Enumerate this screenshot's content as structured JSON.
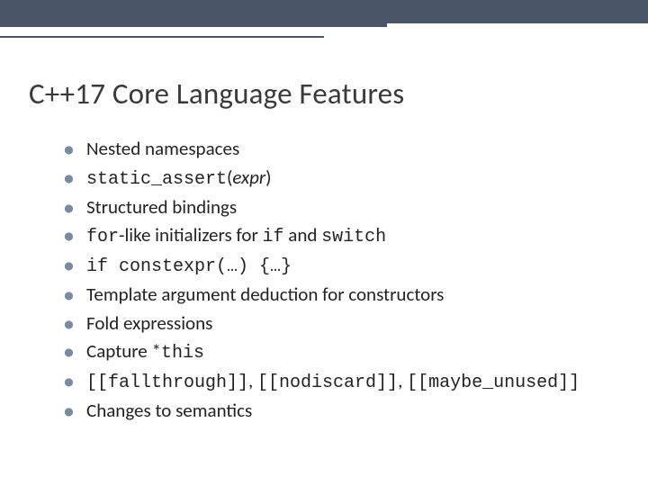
{
  "title": "C++17 Core Language Features",
  "bullets": {
    "b1": "Nested namespaces",
    "b2a": "static_assert",
    "b2b": "(",
    "b2c": "expr",
    "b2d": ")",
    "b3": "Structured bindings",
    "b4a": "for",
    "b4b": "-like initializers for ",
    "b4c": "if",
    "b4d": " and ",
    "b4e": "switch",
    "b5": "if constexpr(…) {…}",
    "b6": "Template argument deduction for constructors",
    "b7": "Fold expressions",
    "b8a": "Capture *",
    "b8b": "this",
    "b9a": "[[fallthrough]]",
    "b9b": ", ",
    "b9c": "[[nodiscard]]",
    "b9d": ", ",
    "b9e": "[[maybe_unused]]",
    "b10": "Changes to semantics"
  }
}
